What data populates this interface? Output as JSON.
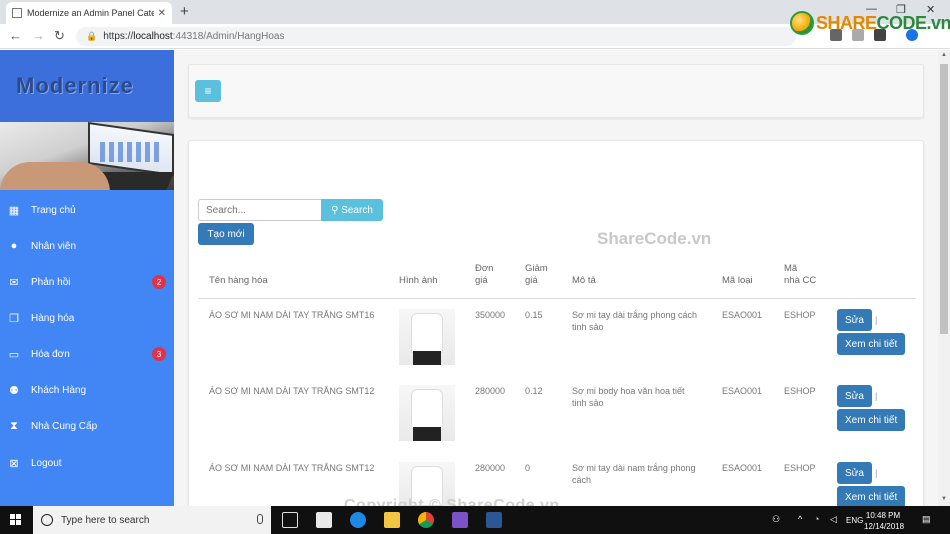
{
  "browser": {
    "tab_title": "Modernize an Admin Panel Categ",
    "url_scheme": "https://",
    "url_host": "localhost",
    "url_rest": ":44318/Admin/HangHoas"
  },
  "watermark": {
    "logo_a": "SHARE",
    "logo_b": "CODE.vn",
    "center": "ShareCode.vn",
    "bottom": "Copyright © ShareCode.vn"
  },
  "sidebar": {
    "brand": "Modernize",
    "items": [
      {
        "label": "Trang chủ",
        "icon": "grid-icon"
      },
      {
        "label": "Nhân viên",
        "icon": "user-icon"
      },
      {
        "label": "Phản hồi",
        "icon": "mail-icon",
        "badge": "2"
      },
      {
        "label": "Hàng hóa",
        "icon": "window-icon"
      },
      {
        "label": "Hóa đơn",
        "icon": "money-icon",
        "badge": "3"
      },
      {
        "label": "Khách Hàng",
        "icon": "users-icon"
      },
      {
        "label": "Nhà Cung Cấp",
        "icon": "hourglass-icon"
      },
      {
        "label": "Logout",
        "icon": "logout-icon"
      }
    ]
  },
  "toolbar": {
    "search_placeholder": "Search...",
    "search_label": "Search",
    "create_label": "Tạo mới"
  },
  "table": {
    "headers": {
      "name": "Tên hàng hóa",
      "image": "Hình ảnh",
      "price_a": "Đơn",
      "price_b": "giá",
      "discount_a": "Giảm",
      "discount_b": "giá",
      "desc": "Mô tả",
      "category": "Mã loại",
      "supplier_a": "Mã",
      "supplier_b": "nhà CC"
    },
    "edit_label": "Sửa",
    "detail_label": "Xem chi tiết",
    "rows": [
      {
        "name": "ÁO SƠ MI NAM DÀI TAY TRẮNG SMT16",
        "price": "350000",
        "discount": "0.15",
        "desc_a": "Sơ mi tay dài trắng phong cách",
        "desc_b": "tinh sảo",
        "category": "ESAO001",
        "supplier": "ESHOP"
      },
      {
        "name": "ÁO SƠ MI NAM DÀI TAY TRẮNG SMT12",
        "price": "280000",
        "discount": "0.12",
        "desc_a": "Sơ mi body hoa văn hoa tiết",
        "desc_b": "tinh sảo",
        "category": "ESAO001",
        "supplier": "ESHOP"
      },
      {
        "name": "ÁO SƠ MI NAM DÀI TAY TRẮNG SMT12",
        "price": "280000",
        "discount": "0",
        "desc_a": "Sơ mi tay dài nam trắng phong",
        "desc_b": "cách",
        "category": "ESAO001",
        "supplier": "ESHOP"
      }
    ]
  },
  "taskbar": {
    "search_text": "Type here to search",
    "lang": "ENG",
    "time": "10:48 PM",
    "date": "12/14/2018"
  }
}
